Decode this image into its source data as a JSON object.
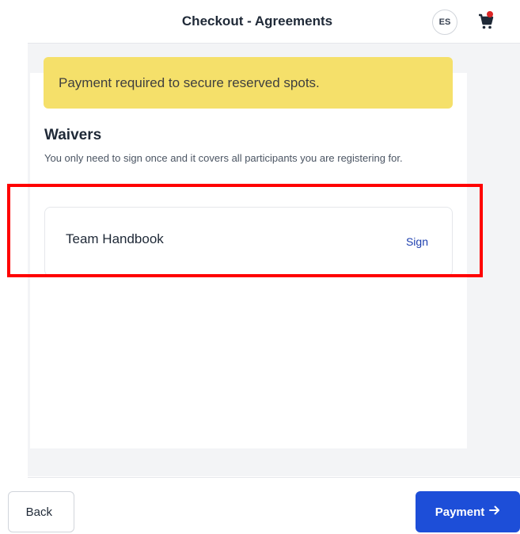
{
  "header": {
    "title": "Checkout - Agreements",
    "lang_label": "ES",
    "cart_icon": "cart-icon",
    "cart_badge_color": "#dc2626"
  },
  "alert": {
    "text": "Payment required to secure reserved spots.",
    "background": "#f5e06a"
  },
  "waivers": {
    "title": "Waivers",
    "description": "You only need to sign once and it covers all participants you are registering for.",
    "items": [
      {
        "name": "Team Handbook",
        "action_label": "Sign"
      }
    ]
  },
  "footer": {
    "back_label": "Back",
    "next_label": "Payment",
    "next_icon": "arrow-right-icon",
    "accent": "#1d4ed8"
  }
}
